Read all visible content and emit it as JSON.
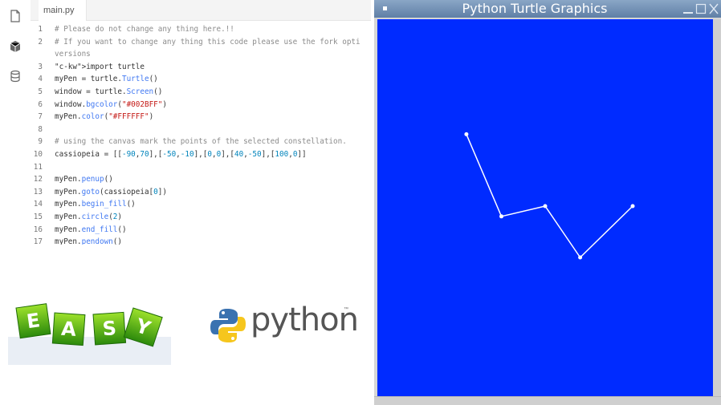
{
  "editor": {
    "tab_label": "main.py",
    "lines": [
      {
        "n": "1",
        "t": "# Please do not change any thing here.!!",
        "k": "comment"
      },
      {
        "n": "2",
        "t": "# If you want to change any thing this code please use the fork opti",
        "k": "comment"
      },
      {
        "n": "",
        "t": "versions",
        "k": "comment"
      },
      {
        "n": "3",
        "t": "import turtle",
        "k": "import"
      },
      {
        "n": "4",
        "t": "myPen = turtle.Turtle()",
        "k": "code"
      },
      {
        "n": "5",
        "t": "window = turtle.Screen()",
        "k": "code"
      },
      {
        "n": "6",
        "t": "window.bgcolor(\"#002BFF\")",
        "k": "code"
      },
      {
        "n": "7",
        "t": "myPen.color(\"#FFFFFF\")",
        "k": "code"
      },
      {
        "n": "8",
        "t": "",
        "k": "code"
      },
      {
        "n": "9",
        "t": "# using the canvas mark the points of the selected constellation.",
        "k": "comment"
      },
      {
        "n": "10",
        "t": "cassiopeia = [[-90,70],[-50,-10],[0,0],[40,-50],[100,0]]",
        "k": "code"
      },
      {
        "n": "11",
        "t": "",
        "k": "code"
      },
      {
        "n": "12",
        "t": "myPen.penup()",
        "k": "code"
      },
      {
        "n": "13",
        "t": "myPen.goto(cassiopeia[0])",
        "k": "code"
      },
      {
        "n": "14",
        "t": "myPen.begin_fill()",
        "k": "code"
      },
      {
        "n": "15",
        "t": "myPen.circle(2)",
        "k": "code"
      },
      {
        "n": "16",
        "t": "myPen.end_fill()",
        "k": "code"
      },
      {
        "n": "17",
        "t": "myPen.pendown()",
        "k": "code"
      }
    ]
  },
  "images": {
    "easy_letters": [
      "E",
      "A",
      "S",
      "Y"
    ],
    "python_wordmark": "python",
    "trademark": "™"
  },
  "turtle_window": {
    "title": "Python Turtle Graphics",
    "bgcolor": "#002BFF",
    "pen_color": "#FFFFFF",
    "constellation_points": [
      [
        -90,
        70
      ],
      [
        -50,
        -10
      ],
      [
        0,
        0
      ],
      [
        40,
        -50
      ],
      [
        100,
        0
      ]
    ]
  }
}
